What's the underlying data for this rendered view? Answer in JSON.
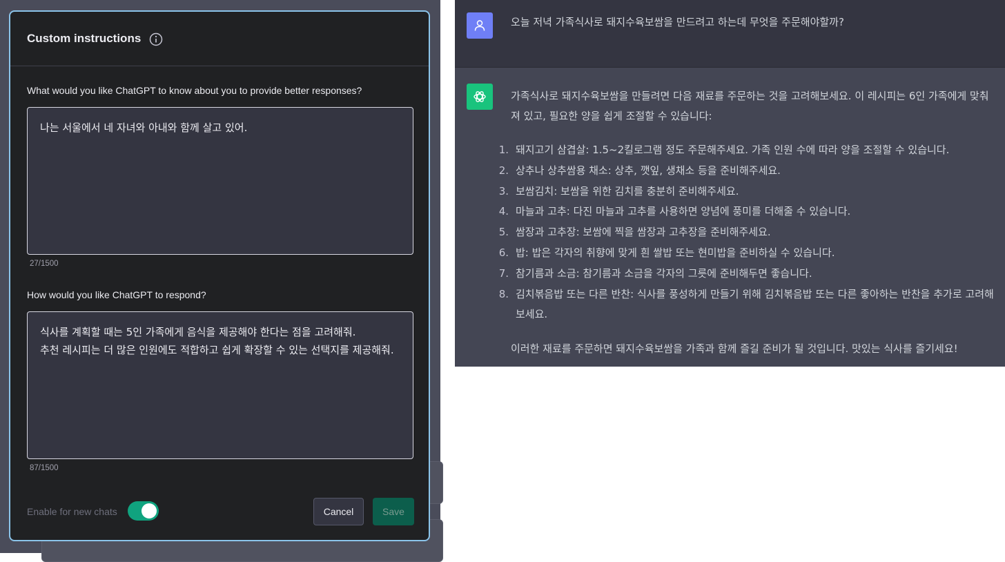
{
  "modal": {
    "title": "Custom instructions",
    "about_label": "What would you like ChatGPT to know about you to provide better responses?",
    "about_value": "나는 서울에서 네 자녀와 아내와 함께 살고 있어.",
    "about_counter": "27/1500",
    "respond_label": "How would you like ChatGPT to respond?",
    "respond_value": "식사를 계획할 때는 5인 가족에게 음식을 제공해야 한다는 점을 고려해줘.\n추천 레시피는 더 많은 인원에도 적합하고 쉽게 확장할 수 있는 선택지를 제공해줘.",
    "respond_counter": "87/1500",
    "toggle_label": "Enable for new chats",
    "toggle_on": true,
    "cancel_label": "Cancel",
    "save_label": "Save",
    "accent_color": "#10a37f"
  },
  "chat": {
    "user_message": "오늘 저녁 가족식사로 돼지수육보쌈을 만드려고 하는데 무엇을 주문해야할까?",
    "assistant_intro": "가족식사로 돼지수육보쌈을 만들려면 다음 재료를 주문하는 것을 고려해보세요. 이 레시피는 6인 가족에게 맞춰져 있고, 필요한 양을 쉽게 조절할 수 있습니다:",
    "items": [
      {
        "num": "1.",
        "text": "돼지고기 삼겹살: 1.5~2킬로그램 정도 주문해주세요. 가족 인원 수에 따라 양을 조절할 수 있습니다."
      },
      {
        "num": "2.",
        "text": "상추나 상추쌈용 채소: 상추, 깻잎, 생채소 등을 준비해주세요."
      },
      {
        "num": "3.",
        "text": "보쌈김치: 보쌈을 위한 김치를 충분히 준비해주세요."
      },
      {
        "num": "4.",
        "text": "마늘과 고추: 다진 마늘과 고추를 사용하면 양념에 풍미를 더해줄 수 있습니다."
      },
      {
        "num": "5.",
        "text": "쌈장과 고추장: 보쌈에 찍을 쌈장과 고추장을 준비해주세요."
      },
      {
        "num": "6.",
        "text": "밥: 밥은 각자의 취향에 맞게 흰 쌀밥 또는 현미밥을 준비하실 수 있습니다."
      },
      {
        "num": "7.",
        "text": "참기름과 소금: 참기름과 소금을 각자의 그릇에 준비해두면 좋습니다."
      },
      {
        "num": "8.",
        "text": "김치볶음밥 또는 다른 반찬: 식사를 풍성하게 만들기 위해 김치볶음밥 또는 다른 좋아하는 반찬을 추가로 고려해보세요."
      }
    ],
    "assistant_outro": "이러한 재료를 주문하면 돼지수육보쌈을 가족과 함께 즐길 준비가 될 것입니다. 맛있는 식사를 즐기세요!",
    "user_avatar_color": "#6f7ff6",
    "assistant_avatar_color": "#19c37d"
  }
}
